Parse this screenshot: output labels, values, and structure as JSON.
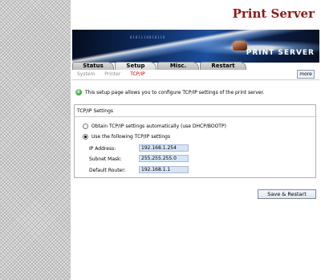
{
  "brand": {
    "title": "Print Server"
  },
  "banner": {
    "title": "PRINT SERVER",
    "digits": "0101110010110"
  },
  "tabs": [
    {
      "label": "Status"
    },
    {
      "label": "Setup"
    },
    {
      "label": "Misc."
    },
    {
      "label": "Restart"
    }
  ],
  "subnav": [
    {
      "label": "System"
    },
    {
      "label": "Printer"
    },
    {
      "label": "TCP/IP"
    }
  ],
  "more_label": "more",
  "info": {
    "icon": "i",
    "text": "This setup page allows you to configure TCP/IP settings of the print server."
  },
  "tcpip": {
    "header": "TCP/IP Settings",
    "option_dhcp": "Obtain TCP/IP settings automatically (use DHCP/BOOTP)",
    "option_static": "Use the following TCP/IP settings",
    "ip_label": "IP Address:",
    "ip_value": "192.168.1.254",
    "mask_label": "Subnet Mask:",
    "mask_value": "255.255.255.0",
    "router_label": "Default Router:",
    "router_value": "192.168.1.1"
  },
  "save_label": "Save & Restart",
  "colors": {
    "brand": "#8b1a1a",
    "active_subnav": "#c00000",
    "field_bg": "#d6e4f4"
  }
}
